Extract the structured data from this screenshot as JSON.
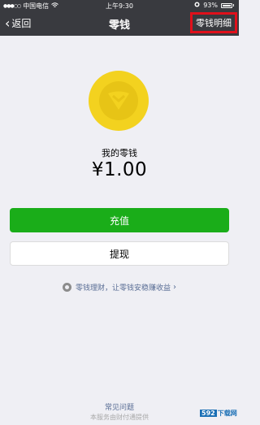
{
  "status_bar": {
    "carrier": "中国电信",
    "time": "上午9:30",
    "battery": "93%"
  },
  "nav": {
    "back_label": "返回",
    "title": "零钱",
    "detail_label": "零钱明细"
  },
  "balance": {
    "label": "我的零钱",
    "amount": "¥1.00"
  },
  "buttons": {
    "topup": "充值",
    "withdraw": "提现"
  },
  "promo": {
    "text": "零钱理财，让零钱安稳赚收益"
  },
  "footer": {
    "faq": "常见问题",
    "provider": "本服务由财付通提供"
  },
  "watermark": {
    "badge": "592",
    "text": "下载网"
  },
  "colors": {
    "nav_bg": "#393a3f",
    "primary_green": "#1aad19",
    "coin_yellow": "#f3d21f",
    "highlight_red": "#e0101b",
    "link_blue": "#586c94"
  }
}
